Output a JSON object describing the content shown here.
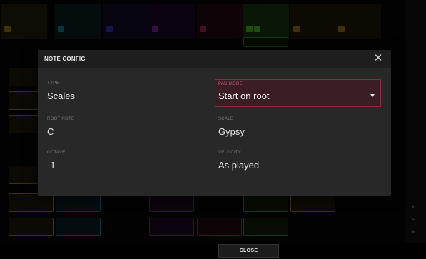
{
  "dialog": {
    "title": "NOTE CONFIG",
    "fields": {
      "type": {
        "label": "TYPE",
        "value": "Scales"
      },
      "pad_mode": {
        "label": "PAD MODE",
        "value": "Start on root"
      },
      "root_note": {
        "label": "ROOT NOTE",
        "value": "C"
      },
      "scale": {
        "label": "SCALE",
        "value": "Gypsy"
      },
      "octave": {
        "label": "OCTAVE",
        "value": "-1"
      },
      "velocity": {
        "label": "VELOCITY",
        "value": "As played"
      }
    }
  },
  "footer": {
    "close_label": "CLOSE"
  },
  "colors": {
    "accent": "#8a2b3f",
    "modal_bg": "#282828",
    "gold_track": "#a58a2a",
    "teal_track": "#2da8b8",
    "purple_track": "#a553c8",
    "red_track": "#c44573",
    "green_track": "#58b030"
  }
}
